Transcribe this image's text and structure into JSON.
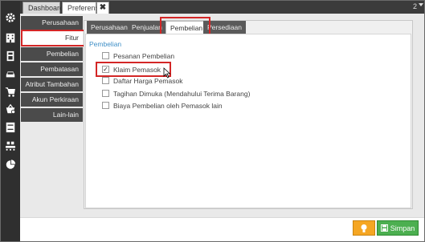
{
  "top_tabs": {
    "dashboard": "Dashboard",
    "preferences": "Preferensi",
    "close_symbol": "✖"
  },
  "window_indicator": "2",
  "sidebar": {
    "items": [
      {
        "label": "Perusahaan"
      },
      {
        "label": "Fitur"
      },
      {
        "label": "Pembelian"
      },
      {
        "label": "Pembatasan"
      },
      {
        "label": "Atribut Tambahan"
      },
      {
        "label": "Akun Perkiraan"
      },
      {
        "label": "Lain-lain"
      }
    ],
    "active_index": 1
  },
  "sub_tabs": {
    "items": [
      {
        "label": "Perusahaan"
      },
      {
        "label": "Penjualan"
      },
      {
        "label": "Pembelian"
      },
      {
        "label": "Persediaan"
      }
    ],
    "active_index": 2
  },
  "section": {
    "title": "Pembelian",
    "options": [
      {
        "label": "Pesanan Pembelian",
        "checked": false
      },
      {
        "label": "Klaim Pemasok",
        "checked": true
      },
      {
        "label": "Daftar Harga Pemasok",
        "checked": false
      },
      {
        "label": "Tagihan Dimuka (Mendahului Terima Barang)",
        "checked": false
      },
      {
        "label": "Biaya Pembelian oleh Pemasok lain",
        "checked": false
      }
    ]
  },
  "footer": {
    "save_label": "Simpan"
  },
  "icons": {
    "left_bar": [
      "gear-icon",
      "building-icon",
      "calculator-icon",
      "car-icon",
      "cart-icon",
      "basket-icon",
      "archive-icon",
      "conveyor-icon",
      "pie-chart-icon"
    ],
    "bulb": "lightbulb-icon",
    "save": "save-icon"
  },
  "colors": {
    "highlight": "#d32626",
    "save_button": "#4caf50",
    "bulb_button": "#f5a623",
    "section_title": "#3f8fc7"
  }
}
